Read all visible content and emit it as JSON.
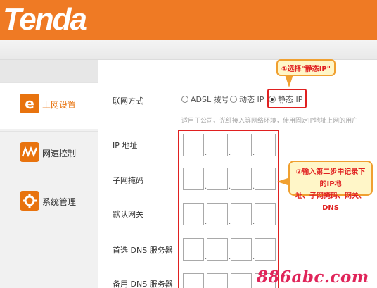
{
  "brand": {
    "logo_text": "Tenda",
    "accent": "#ef7a24"
  },
  "sidebar": {
    "items": [
      {
        "label": "上网设置",
        "icon": "ie-icon",
        "active": true
      },
      {
        "label": "网速控制",
        "icon": "speed-icon",
        "active": false
      },
      {
        "label": "系统管理",
        "icon": "gear-icon",
        "active": false
      }
    ]
  },
  "form": {
    "connection_type": {
      "label": "联网方式",
      "options": [
        "ADSL 拨号",
        "动态 IP",
        "静态 IP"
      ],
      "selected": "静态 IP"
    },
    "hint": "适用于公司、光纤接入等网络环境，使用固定IP地址上网的用户",
    "fields": [
      {
        "label": "IP 地址"
      },
      {
        "label": "子网掩码"
      },
      {
        "label": "默认网关"
      },
      {
        "label": "首选 DNS 服务器"
      },
      {
        "label": "备用 DNS 服务器"
      }
    ]
  },
  "annotations": {
    "step1": "①选择\"静态IP\"",
    "step2_line1": "②输入第二步中记录下的IP地",
    "step2_line2": "址、子网掩码、网关、DNS"
  },
  "watermark": "886abc.com"
}
